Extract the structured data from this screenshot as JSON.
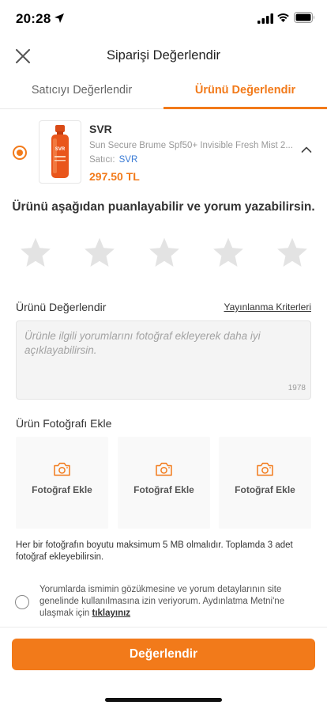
{
  "status_bar": {
    "time": "20:28"
  },
  "nav": {
    "title": "Siparişi Değerlendir"
  },
  "tabs": [
    {
      "label": "Satıcıyı Değerlendir",
      "active": false
    },
    {
      "label": "Ürünü Değerlendir",
      "active": true
    }
  ],
  "product": {
    "brand": "SVR",
    "name": "Sun Secure Brume Spf50+ Invisible Fresh Mist 2...",
    "seller_label": "Satıcı:",
    "seller_name": "SVR",
    "price": "297.50 TL",
    "image_label": "SVR"
  },
  "rating": {
    "prompt": "Ürünü aşağıdan puanlayabilir ve yorum yazabilirsin.",
    "max_stars": 5,
    "selected": 0
  },
  "review": {
    "label": "Ürünü Değerlendir",
    "criteria_link": "Yayınlanma Kriterleri",
    "placeholder": "Ürünle ilgili yorumlarını fotoğraf ekleyerek daha iyi açıklayabilirsin.",
    "char_count": "1978"
  },
  "photos": {
    "label": "Ürün Fotoğrafı Ekle",
    "slots": [
      {
        "label": "Fotoğraf Ekle"
      },
      {
        "label": "Fotoğraf Ekle"
      },
      {
        "label": "Fotoğraf Ekle"
      }
    ],
    "info": "Her bir fotoğrafın boyutu maksimum 5 MB olmalıdır. Toplamda 3 adet fotoğraf ekleyebilirsin."
  },
  "consent": {
    "text": "Yorumlarda ismimin gözükmesine ve yorum detaylarının site genelinde kullanılmasına izin veriyorum. Aydınlatma Metni'ne ulaşmak için",
    "link": "tıklayınız"
  },
  "submit_label": "Değerlendir",
  "colors": {
    "accent": "#f27a1a",
    "link": "#3a7bd5",
    "star": "#e3e3e3"
  }
}
